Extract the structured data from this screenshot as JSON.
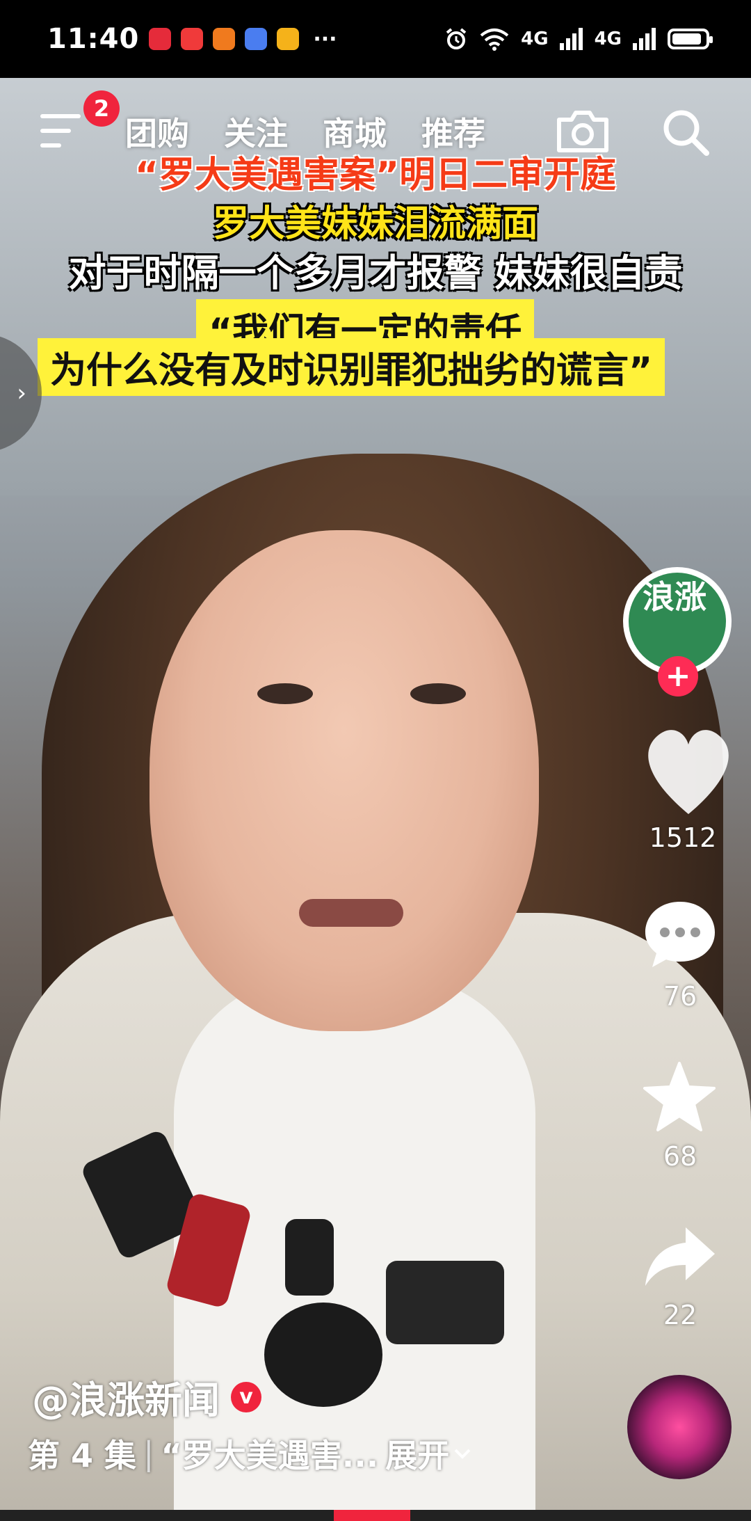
{
  "status_bar": {
    "time": "11:40",
    "more": "···",
    "network1": "4G",
    "network2": "4G",
    "battery_level": 0.9,
    "app_icons": [
      "huawei-app-icon",
      "mail-app-icon",
      "shop-app-icon",
      "music-app-icon",
      "video-app-icon"
    ]
  },
  "top_nav": {
    "badge_count": "2",
    "tabs": [
      "团购",
      "关注",
      "商城",
      "推荐"
    ]
  },
  "captions": {
    "line1": "“罗大美遇害案”明日二审开庭",
    "line2": "罗大美妹妹泪流满面",
    "line3": "对于时隔一个多月才报警 妹妹很自责",
    "quote1": "“我们有一定的责任",
    "quote2": "为什么没有及时识别罪犯拙劣的谎言”"
  },
  "side_tab": {
    "arrow": "›"
  },
  "creator": {
    "avatar_text": "浪涨",
    "follow": "+"
  },
  "actions": {
    "likes": "1512",
    "comments": "76",
    "favorites": "68",
    "shares": "22"
  },
  "video_info": {
    "author": "@浪涨新闻",
    "verified_mark": "v",
    "episode": "第 4 集",
    "separator": "|",
    "title": "“罗大美遇害...",
    "expand_label": "展开",
    "expand_icon": "chevron-down-icon"
  },
  "playback": {
    "progress": 0.46
  },
  "colors": {
    "accent_red": "#f0243d",
    "caption_yellow": "#fff23a",
    "caption_orange": "#f53b17"
  }
}
